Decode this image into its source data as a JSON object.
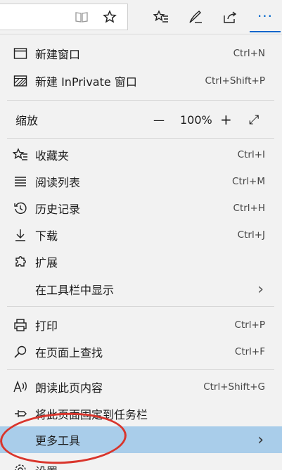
{
  "toolbar": {
    "icons": [
      "reading-view-icon",
      "favorite-star-icon",
      "favorites-list-icon",
      "pen-icon",
      "share-icon",
      "more-icon"
    ],
    "more_label": "···"
  },
  "menu": {
    "new_window": {
      "label": "新建窗口",
      "shortcut": "Ctrl+N"
    },
    "new_private": {
      "label": "新建 InPrivate 窗口",
      "shortcut": "Ctrl+Shift+P"
    },
    "zoom": {
      "label": "缩放",
      "minus": "—",
      "value": "100%",
      "plus": "+",
      "fullscreen": "⤢"
    },
    "favorites": {
      "label": "收藏夹",
      "shortcut": "Ctrl+I"
    },
    "reading_list": {
      "label": "阅读列表",
      "shortcut": "Ctrl+M"
    },
    "history": {
      "label": "历史记录",
      "shortcut": "Ctrl+H"
    },
    "downloads": {
      "label": "下载",
      "shortcut": "Ctrl+J"
    },
    "extensions": {
      "label": "扩展"
    },
    "show_in_toolbar": {
      "label": "在工具栏中显示",
      "chevron": "›"
    },
    "print": {
      "label": "打印",
      "shortcut": "Ctrl+P"
    },
    "find_on_page": {
      "label": "在页面上查找",
      "shortcut": "Ctrl+F"
    },
    "read_aloud": {
      "label": "朗读此页内容",
      "shortcut": "Ctrl+Shift+G"
    },
    "pin_taskbar": {
      "label": "将此页面固定到任务栏"
    },
    "more_tools": {
      "label": "更多工具",
      "chevron": "›"
    },
    "settings": {
      "label": "设置"
    }
  },
  "colors": {
    "accent": "#0066cc",
    "highlight": "#a9cdea",
    "annotation_circle": "#d9352c"
  }
}
